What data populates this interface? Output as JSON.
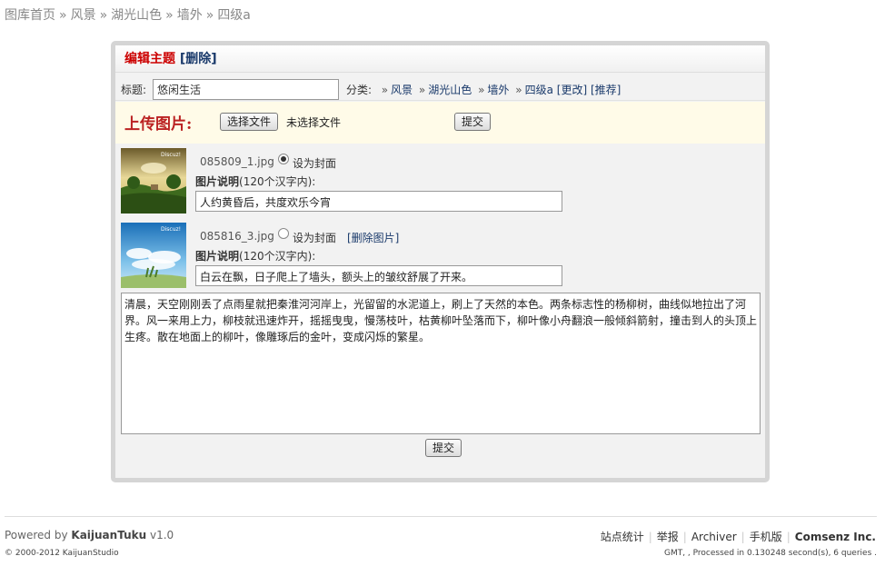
{
  "breadcrumb": {
    "items": [
      "图库首页",
      "风景",
      "湖光山色",
      "墙外",
      "四级a"
    ],
    "separator": "»"
  },
  "panel": {
    "title": "编辑主题",
    "delete_link": "[删除]",
    "title_label": "标题:",
    "title_value": "悠闲生活",
    "category_label": "分类:",
    "category_path": [
      "风景",
      "湖光山色",
      "墙外",
      "四级a"
    ],
    "category_sep": "»",
    "change_link": "[更改]",
    "recommend_link": "[推荐]",
    "upload_label": "上传图片:",
    "choose_file": "选择文件",
    "no_file": "未选择文件",
    "submit": "提交"
  },
  "images": [
    {
      "filename": "085809_1.jpg",
      "cover_label": "设为封面",
      "cover_selected": true,
      "delete_link": "",
      "desc_label": "图片说明",
      "desc_hint": "(120个汉字内):",
      "desc_value": "人约黄昏后，共度欢乐今宵",
      "watermark": "Discuz!"
    },
    {
      "filename": "085816_3.jpg",
      "cover_label": "设为封面",
      "cover_selected": false,
      "delete_link": "[删除图片]",
      "desc_label": "图片说明",
      "desc_hint": "(120个汉字内):",
      "desc_value": "白云在飘，日子爬上了墙头，额头上的皱纹舒展了开来。",
      "watermark": "Discuz!"
    }
  ],
  "content_text": "清晨，天空刚刚丢了点雨星就把秦淮河河岸上，光留留的水泥道上，刷上了天然的本色。两条标志性的杨柳树，曲线似地拉出了河界。风一来用上力，柳枝就迅速炸开，摇摇曳曳，慢荡枝叶，枯黄柳叶坠落而下，柳叶像小舟翻浪一般倾斜箭射，撞击到人的头顶上生疼。散在地面上的柳叶，像雕琢后的金叶，变成闪烁的繁星。",
  "footer": {
    "powered_prefix": "Powered by",
    "powered_name": "KaijuanTuku",
    "powered_version": "v1.0",
    "copyright": "© 2000-2012 KaijuanStudio",
    "links": [
      "站点统计",
      "举报",
      "Archiver",
      "手机版"
    ],
    "brand": "Comsenz Inc.",
    "stats": "GMT, , Processed in 0.130248 second(s), 6 queries ."
  }
}
